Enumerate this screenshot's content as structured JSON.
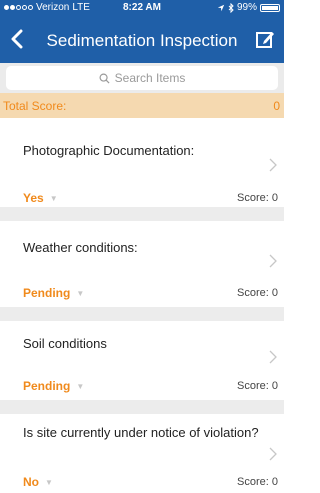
{
  "status_bar": {
    "carrier": "Verizon",
    "network": "LTE",
    "time": "8:22 AM",
    "battery": "99%",
    "signal_filled": 2,
    "signal_total": 5,
    "battery_level": 0.99
  },
  "nav": {
    "title": "Sedimentation Inspection",
    "back_icon": "chevron-left-icon",
    "edit_icon": "edit-icon"
  },
  "search": {
    "placeholder": "Search Items",
    "icon": "search-icon"
  },
  "total_score": {
    "label": "Total Score:",
    "value": "0"
  },
  "items": [
    {
      "question": "Photographic Documentation:",
      "answer": "Yes",
      "score": "Score: 0"
    },
    {
      "question": "Weather conditions:",
      "answer": "Pending",
      "score": "Score: 0"
    },
    {
      "question": "Soil conditions",
      "answer": "Pending",
      "score": "Score: 0"
    },
    {
      "question": "Is site currently under notice of violation?",
      "answer": "No",
      "score": "Score: 0"
    }
  ],
  "colors": {
    "header": "#1f5fa8",
    "accent": "#f08a1c",
    "score_bar": "#f5d9b0",
    "separator": "#ececec"
  }
}
